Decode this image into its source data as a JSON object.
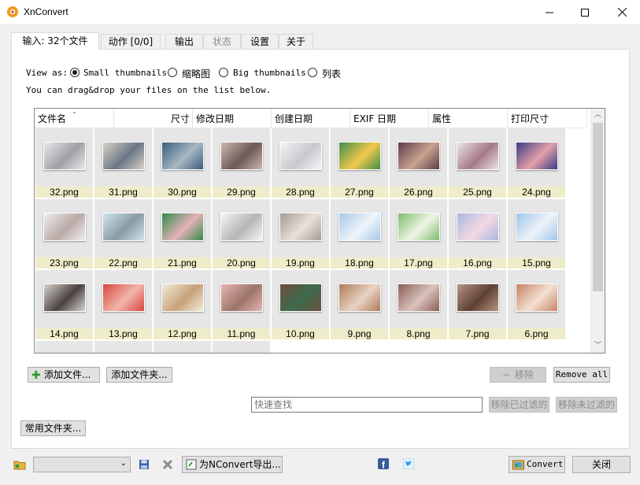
{
  "window": {
    "title": "XnConvert",
    "controls": {
      "minimize": "—",
      "maximize": "☐",
      "close": "✕"
    }
  },
  "tabs": [
    {
      "label": "输入:  32个文件",
      "state": "active"
    },
    {
      "label": "动作 [0/0]",
      "state": "normal"
    },
    {
      "label": "输出",
      "state": "normal"
    },
    {
      "label": "状态",
      "state": "disabled"
    },
    {
      "label": "设置",
      "state": "normal"
    },
    {
      "label": "关于",
      "state": "normal"
    }
  ],
  "view": {
    "label": "View as:",
    "options": [
      "Small thumbnails",
      "缩略图",
      "Big thumbnails",
      "列表"
    ],
    "selected": "Small thumbnails",
    "hint": "You can drag&drop your files on the list below."
  },
  "columns": [
    "文件名",
    "尺寸",
    "修改日期",
    "创建日期",
    "EXIF 日期",
    "属性",
    "打印尺寸"
  ],
  "files": [
    {
      "name": "32.png",
      "colors": [
        "#e9e9ea",
        "#9fa0a6"
      ]
    },
    {
      "name": "31.png",
      "colors": [
        "#d8d2c6",
        "#6a7786"
      ]
    },
    {
      "name": "30.png",
      "colors": [
        "#3a5d7a",
        "#a9b8c4"
      ]
    },
    {
      "name": "29.png",
      "colors": [
        "#c9b8b0",
        "#6e5a55"
      ]
    },
    {
      "name": "28.png",
      "colors": [
        "#f4f4f4",
        "#c8c8d0"
      ]
    },
    {
      "name": "27.png",
      "colors": [
        "#3f8f4c",
        "#f2c84b"
      ]
    },
    {
      "name": "26.png",
      "colors": [
        "#5b3c4a",
        "#c9a38f"
      ]
    },
    {
      "name": "25.png",
      "colors": [
        "#ebe4e6",
        "#a57a86"
      ]
    },
    {
      "name": "24.png",
      "colors": [
        "#3b3b86",
        "#e3a0a8"
      ]
    },
    {
      "name": "23.png",
      "colors": [
        "#eeeeee",
        "#b9aaa6"
      ]
    },
    {
      "name": "22.png",
      "colors": [
        "#cfe4ef",
        "#8a9ba4"
      ]
    },
    {
      "name": "21.png",
      "colors": [
        "#2f8a4b",
        "#e6b2b8"
      ]
    },
    {
      "name": "20.png",
      "colors": [
        "#f6f6f6",
        "#b5b5b5"
      ]
    },
    {
      "name": "19.png",
      "colors": [
        "#a69a92",
        "#e8e1da"
      ]
    },
    {
      "name": "18.png",
      "colors": [
        "#a7c8e6",
        "#eef5fb"
      ]
    },
    {
      "name": "17.png",
      "colors": [
        "#7cbd6a",
        "#f1f4e8"
      ]
    },
    {
      "name": "16.png",
      "colors": [
        "#aab8e3",
        "#f3d8e2"
      ]
    },
    {
      "name": "15.png",
      "colors": [
        "#9fc5e9",
        "#eef3f8"
      ]
    },
    {
      "name": "14.png",
      "colors": [
        "#d9d4cf",
        "#4a4240"
      ]
    },
    {
      "name": "13.png",
      "colors": [
        "#d9453f",
        "#f0b6a9"
      ]
    },
    {
      "name": "12.png",
      "colors": [
        "#f2ebd8",
        "#c8a27a"
      ]
    },
    {
      "name": "11.png",
      "colors": [
        "#e9b5b3",
        "#9a7469"
      ]
    },
    {
      "name": "10.png",
      "colors": [
        "#6a4f3f",
        "#3d6b4c"
      ]
    },
    {
      "name": "9.png",
      "colors": [
        "#b17b59",
        "#e7d3c3"
      ]
    },
    {
      "name": "8.png",
      "colors": [
        "#8a5d55",
        "#d9c3bc"
      ]
    },
    {
      "name": "7.png",
      "colors": [
        "#b59483",
        "#5e4134"
      ]
    },
    {
      "name": "6.png",
      "colors": [
        "#c78362",
        "#f3e0d2"
      ]
    }
  ],
  "buttons": {
    "add_files": "添加文件...",
    "add_folder": "添加文件夹...",
    "remove": "移除",
    "remove_all": "Remove all",
    "remove_filtered": "移除已过滤的",
    "remove_unfiltered": "移除未过滤的",
    "common_folders": "常用文件夹...",
    "export": "为NConvert导出...",
    "convert": "Convert",
    "close": "关闭"
  },
  "search": {
    "placeholder": "快速查找"
  },
  "colors": {
    "accent_green": "#2e9d2e",
    "filename_bg": "#efedc9",
    "cell_bg": "#e6e6e6"
  }
}
